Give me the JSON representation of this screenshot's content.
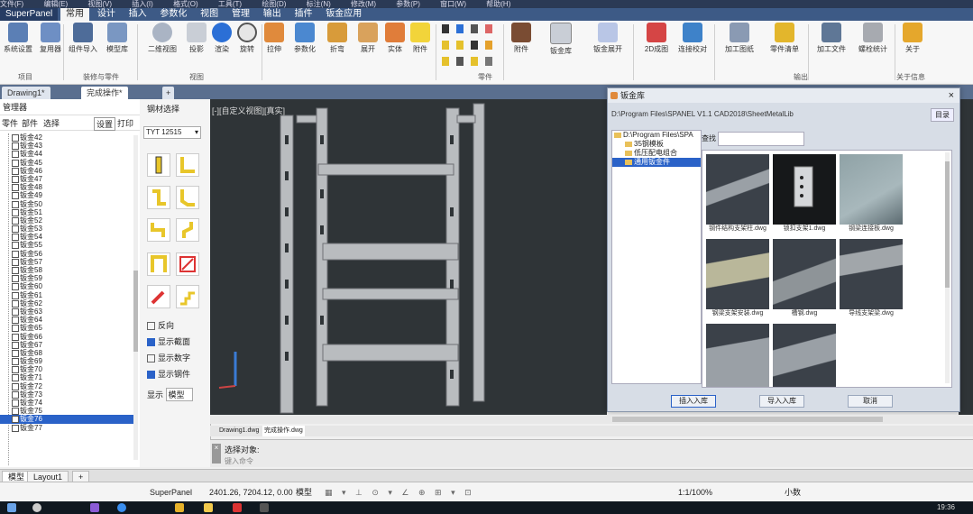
{
  "menubar": [
    "文件(F)",
    "编辑(E)",
    "视图(V)",
    "插入(I)",
    "格式(O)",
    "工具(T)",
    "绘图(D)",
    "标注(N)",
    "修改(M)",
    "参数(P)",
    "窗口(W)",
    "帮助(H)"
  ],
  "ribbon": {
    "brand": "SuperPanel",
    "tabs": [
      "常用",
      "设计",
      "插入",
      "参数化",
      "视图",
      "管理",
      "输出",
      "插件",
      "钣金应用"
    ],
    "buttons": {
      "system_settings": "系统设置",
      "reuse": "复用器",
      "component_import": "组件导入",
      "model_library": "模型库",
      "two_d_view": "二维视图",
      "projection": "投影",
      "render": "渲染",
      "rotate": "旋转",
      "pull": "拉伸",
      "param": "参数化",
      "bend": "折弯",
      "unfold": "展开",
      "solid": "实体",
      "group_line": "附件",
      "sheet_lib": "钣金库",
      "sheet_unfold": "钣金展开",
      "two_d_gen": "2D成图",
      "connect": "连接校对",
      "process_drawing": "加工图纸",
      "process_form": "零件清单",
      "process_file": "加工文件",
      "tool_stats": "螺栓统计",
      "about": "关于"
    },
    "groups": {
      "project": "项目",
      "component": "装修与零件",
      "view": "视图",
      "part": "零件",
      "output": "输出",
      "about": "关于信息"
    }
  },
  "doc_tabs": [
    "Drawing1*",
    "完成操作*"
  ],
  "left_panel": {
    "title": "管理器",
    "tabs": [
      "零件",
      "部件",
      "选择",
      "设置",
      "打印"
    ],
    "items": [
      "钣金42",
      "钣金43",
      "钣金44",
      "钣金45",
      "钣金46",
      "钣金47",
      "钣金48",
      "钣金49",
      "钣金50",
      "钣金51",
      "钣金52",
      "钣金53",
      "钣金54",
      "钣金55",
      "钣金56",
      "钣金57",
      "钣金58",
      "钣金59",
      "钣金60",
      "钣金61",
      "钣金62",
      "钣金63",
      "钣金64",
      "钣金65",
      "钣金66",
      "钣金67",
      "钣金68",
      "钣金69",
      "钣金70",
      "钣金71",
      "钣金72",
      "钣金73",
      "钣金74",
      "钣金75",
      "钣金76",
      "钣金77"
    ],
    "selected_index": 34
  },
  "tool_panel": {
    "title": "钢材选择",
    "profile_value": "TYT 12515",
    "options": [
      "反向",
      "显示截面",
      "显示数字",
      "显示钢件"
    ],
    "options_checked": [
      false,
      true,
      false,
      true
    ],
    "mode_label": "显示",
    "mode_value": "模型"
  },
  "viewport": {
    "label": "[-][自定义视图][真实]"
  },
  "dialog": {
    "title": "钣金库",
    "path": "D:\\Program Files\\SPANEL V1.1 CAD2018\\SheetMetalLib",
    "root_button": "目录",
    "tree": [
      "D:\\Program Files\\SPA",
      "35钢模板",
      "低压配电组合",
      "通用钣金件"
    ],
    "tree_selected": 3,
    "search_label": "查找",
    "search_placeholder": "",
    "thumbs": [
      "钢件结构支架柱.dwg",
      "锁扣支架1.dwg",
      "钢梁连接板.dwg",
      "钢梁支架安装.dwg",
      "槽钢.dwg",
      "导线支架梁.dwg",
      "",
      ""
    ],
    "buttons": [
      "插入入库",
      "导入入库",
      "取消"
    ]
  },
  "drawing_tabs": [
    "Drawing1.dwg",
    "完成操作.dwg"
  ],
  "command": {
    "head": "选择对象:",
    "input_placeholder": "键入命令"
  },
  "layout_tabs": [
    "模型",
    "Layout1"
  ],
  "status": {
    "app": "SuperPanel",
    "coords": "2401.26, 7204.12, 0.00",
    "mode": "模型",
    "scale": "1:1/100%",
    "units": "小数"
  },
  "taskbar": {
    "time": "19:36"
  },
  "colors": {
    "accent": "#2a62c8",
    "ribbon_tab_bar": "#3d5a86",
    "viewport_bg": "#2f3437"
  }
}
